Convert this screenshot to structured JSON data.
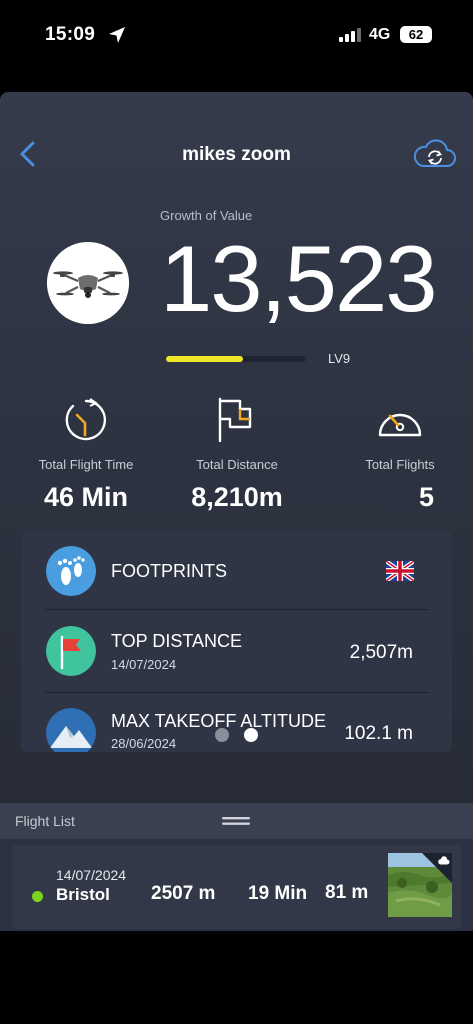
{
  "status_bar": {
    "time": "15:09",
    "network": "4G",
    "battery": "62"
  },
  "header": {
    "title": "mikes zoom"
  },
  "growth": {
    "label": "Growth of Value",
    "value": "13,523",
    "level": "LV9",
    "level_progress": 0.55,
    "level_color": "#f0e62a"
  },
  "stats": [
    {
      "label": "Total Flight Time",
      "value": "46 Min"
    },
    {
      "label": "Total Distance",
      "value": "8,210m"
    },
    {
      "label": "Total Flights",
      "value": "5"
    }
  ],
  "records": [
    {
      "title": "FOOTPRINTS",
      "icon": "footprints-icon",
      "flag": "uk-flag-icon"
    },
    {
      "title": "TOP DISTANCE",
      "date": "14/07/2024",
      "value": "2,507m",
      "icon": "red-flag-icon"
    },
    {
      "title": "MAX TAKEOFF ALTITUDE",
      "date": "28/06/2024",
      "value": "102.1 m",
      "icon": "mountain-icon"
    }
  ],
  "pager": {
    "active_index": 1
  },
  "flight_list": {
    "title": "Flight List",
    "flights": [
      {
        "date": "14/07/2024",
        "location": "Bristol",
        "distance": "2507 m",
        "duration": "19 Min",
        "altitude": "81 m",
        "status_color": "#7ed321"
      }
    ]
  },
  "colors": {
    "accent_blue": "#4a90e2",
    "accent_yellow": "#f5a623"
  }
}
